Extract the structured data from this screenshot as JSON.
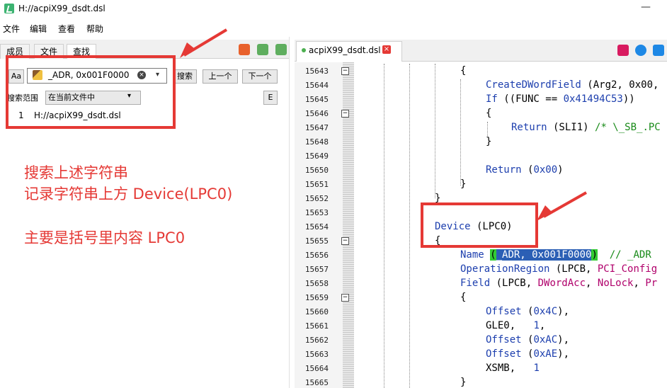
{
  "window": {
    "title": "H://acpiX99_dsdt.dsl",
    "minimize_glyph": "—"
  },
  "menu": [
    "文件",
    "编辑",
    "查看",
    "帮助"
  ],
  "left_tabs": [
    "成员",
    "文件",
    "查找"
  ],
  "search": {
    "case_button": "Aa",
    "value": "_ADR, 0x001F0000",
    "search_button": "搜索",
    "prev_button": "上一个",
    "next_button": "下一个",
    "scope_label": "搜索范围",
    "scope_value": "在当前文件中",
    "e_button": "E"
  },
  "result": {
    "number": "1",
    "path": "H://acpiX99_dsdt.dsl"
  },
  "annotations": {
    "line1": "搜索上述字符串",
    "line2": "记录字符串上方 Device(LPC0)",
    "line3": "主要是括号里内容  LPC0"
  },
  "doc_tab": {
    "label": "acpiX99_dsdt.dsl",
    "close": "×"
  },
  "line_numbers": [
    "15643",
    "15644",
    "15645",
    "15646",
    "15647",
    "15648",
    "15649",
    "15650",
    "15651",
    "15652",
    "15653",
    "15654",
    "15655",
    "15656",
    "15657",
    "15658",
    "15659",
    "15660",
    "15661",
    "15662",
    "15663",
    "15664",
    "15665"
  ],
  "code": {
    "l15643": "{",
    "l15644_fn": "CreateDWordField",
    "l15644_rest": " (Arg2, 0x00,",
    "l15645_kw": "If",
    "l15645_rest": " ((FUNC == ",
    "l15645_num": "0x41494C53",
    "l15645_end": "))",
    "l15646": "{",
    "l15647_kw": "Return",
    "l15647_rest": " (SLI1) ",
    "l15647_cm": "/* \\_SB_.PC",
    "l15648": "}",
    "l15650_kw": "Return",
    "l15650_rest": " (",
    "l15650_num": "0x00",
    "l15650_end": ")",
    "l15651": "}",
    "l15652": "}",
    "l15654_kw": "Device",
    "l15654_rest": " (LPC0)",
    "l15655": "{",
    "l15656_kw": "Name",
    "l15656_open": "(",
    "l15656_hl": "_ADR, 0x001F0000",
    "l15656_close": ")",
    "l15656_cm": "  // _ADR",
    "l15657_kw": "OperationRegion",
    "l15657_rest": " (LPCB, ",
    "l15657_fn": "PCI_Config",
    "l15658_kw": "Field",
    "l15658_rest": " (LPCB, ",
    "l15658_fn1": "DWordAcc",
    "l15658_sep": ", ",
    "l15658_fn2": "NoLock",
    "l15658_sep2": ", ",
    "l15658_fn3": "Pr",
    "l15659": "{",
    "l15660_kw": "Offset",
    "l15660_rest": " (",
    "l15660_num": "0x4C",
    "l15660_end": "),",
    "l15661": "GLE0,   ",
    "l15661_num": "1",
    "l15661_end": ",",
    "l15662_kw": "Offset",
    "l15662_rest": " (",
    "l15662_num": "0xAC",
    "l15662_end": "),",
    "l15663_kw": "Offset",
    "l15663_rest": " (",
    "l15663_num": "0xAE",
    "l15663_end": "),",
    "l15664": "XSMB,   ",
    "l15664_num": "1",
    "l15665": "}"
  },
  "colors": {
    "annotation": "#e53935",
    "keyword": "#1d3fae",
    "comment": "#188a18",
    "highlight": "#2b5fb5",
    "brace_match": "#33cc33"
  }
}
